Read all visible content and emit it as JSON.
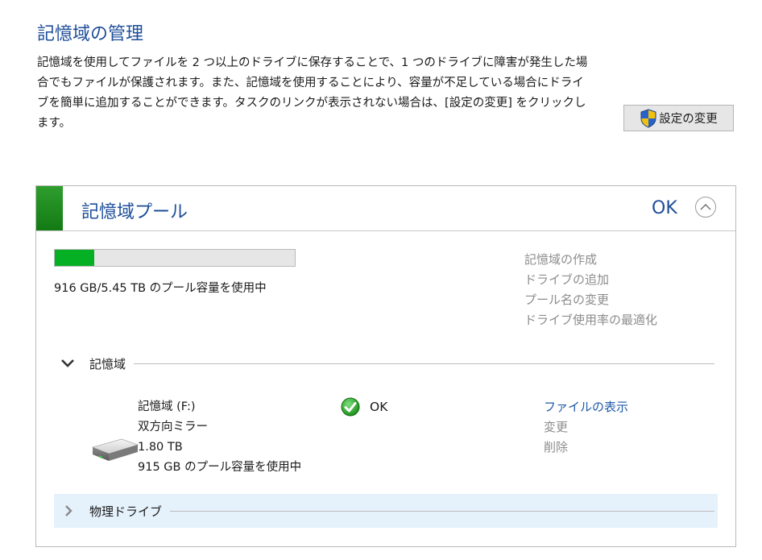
{
  "page": {
    "title": "記憶域の管理",
    "description": [
      "記憶域を使用してファイルを 2 つ以上のドライブに保存することで、1 つのドライブに障害が発生した場",
      "合でもファイルが保護されます。また、記憶域を使用することにより、容量が不足している場合にドライ",
      "ブを簡単に追加することができます。タスクのリンクが表示されない場合は、[設定の変更] をクリックし",
      "ます。"
    ],
    "settings_button": "設定の変更"
  },
  "pool": {
    "title": "記憶域プール",
    "status": "OK",
    "usage_fraction": 0.164,
    "usage_text": "916 GB/5.45 TB のプール容量を使用中",
    "actions": [
      "記憶域の作成",
      "ドライブの追加",
      "プール名の変更",
      "ドライブ使用率の最適化"
    ],
    "spaces_section": {
      "label": "記憶域",
      "space": {
        "name": "記憶域 (F:)",
        "resiliency": "双方向ミラー",
        "size": "1.80 TB",
        "usage": "915 GB のプール容量を使用中",
        "status": "OK",
        "actions": {
          "view_files": "ファイルの表示",
          "change": "変更",
          "delete": "削除"
        }
      }
    },
    "physical_section": {
      "label": "物理ドライブ"
    }
  },
  "colors": {
    "heading_blue": "#1e4e9a",
    "link_blue": "#1e5aa8",
    "disabled_gray": "#8c8c8c",
    "progress_green": "#06b025",
    "selected_row": "#e5f1fb"
  },
  "icons": [
    "uac-shield-icon",
    "chevron-up-icon",
    "chevron-down-icon",
    "chevron-right-icon",
    "drive-icon",
    "ok-check-icon"
  ]
}
